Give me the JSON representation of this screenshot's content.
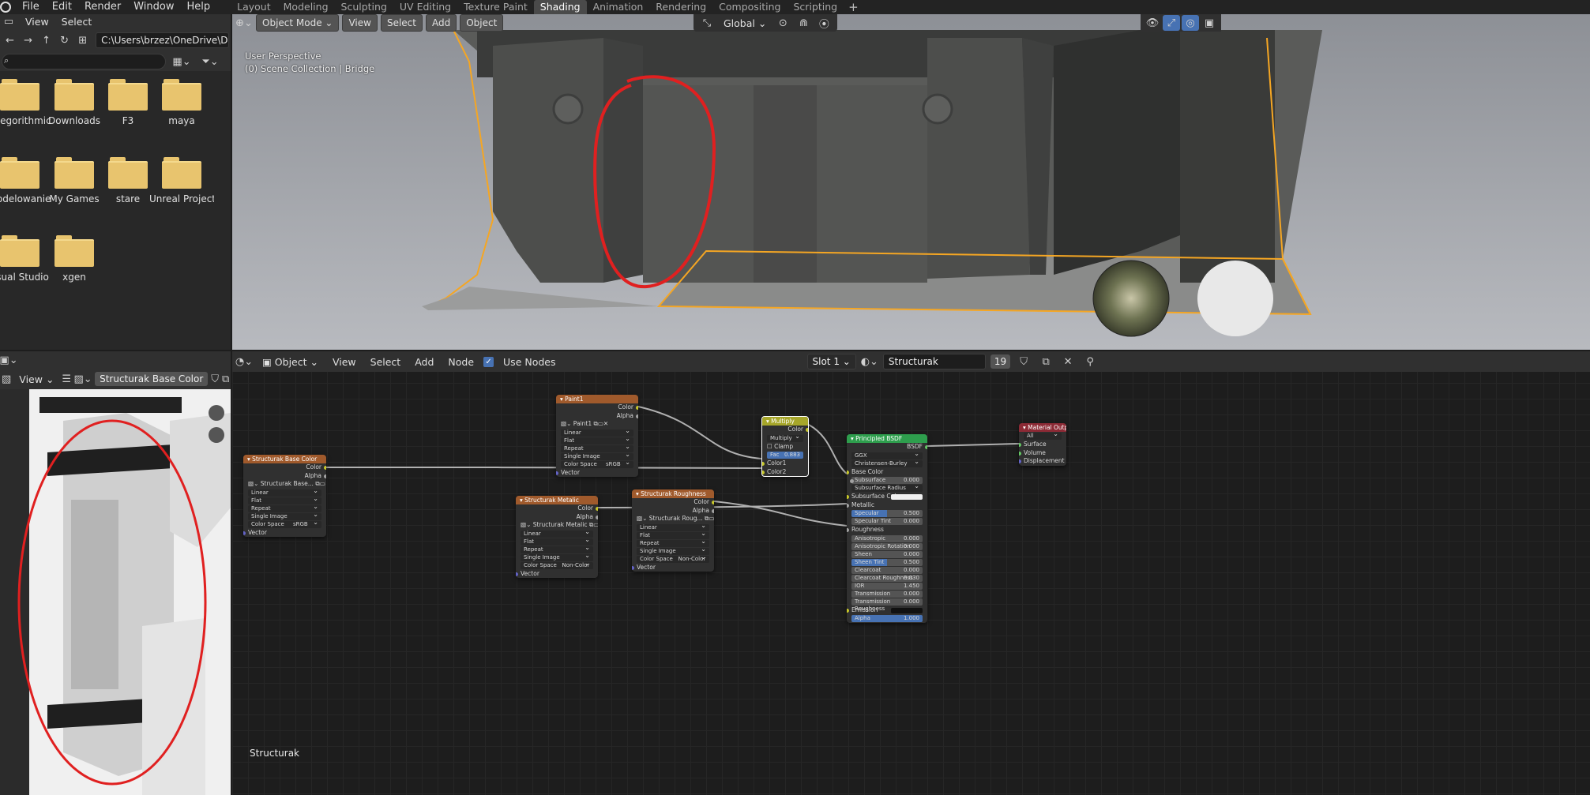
{
  "topbar": {
    "menus": [
      "File",
      "Edit",
      "Render",
      "Window",
      "Help"
    ],
    "workspaces": [
      "Layout",
      "Modeling",
      "Sculpting",
      "UV Editing",
      "Texture Paint",
      "Shading",
      "Animation",
      "Rendering",
      "Compositing",
      "Scripting"
    ],
    "active_workspace": "Shading",
    "add_workspace": "+"
  },
  "filebrowser": {
    "menus": [
      "View",
      "Select"
    ],
    "path": "C:\\Users\\brzez\\OneDrive\\Dokumenty\\",
    "folders": [
      "Allegorithmic",
      "Downloads",
      "F3",
      "maya",
      "Modelowanie",
      "My Games",
      "stare",
      "Unreal Project",
      "Visual Studio ...",
      "xgen"
    ]
  },
  "viewport": {
    "mode": "Object Mode",
    "menus": [
      "View",
      "Select",
      "Add",
      "Object"
    ],
    "transform_orientation": "Global",
    "perspective_label": "User Perspective",
    "collection_label": "(0) Scene Collection | Bridge"
  },
  "imgeditor": {
    "view_menu": "View",
    "image_name": "Structurak Base Color"
  },
  "nodeeditor": {
    "type": "Object",
    "menus": [
      "View",
      "Select",
      "Add",
      "Node"
    ],
    "use_nodes_label": "Use Nodes",
    "slot": "Slot 1",
    "material": "Structurak",
    "users": "19",
    "tree_label": "Structurak",
    "nodes": {
      "base_color": {
        "title": "Structurak Base Color",
        "outputs": [
          "Color",
          "Alpha"
        ],
        "image": "Structurak Base...",
        "interp": "Linear",
        "proj": "Flat",
        "ext": "Repeat",
        "source": "Single Image",
        "colorspace_label": "Color Space",
        "colorspace": "sRGB",
        "vector": "Vector"
      },
      "paint": {
        "title": "Paint1",
        "outputs": [
          "Color",
          "Alpha"
        ],
        "image": "Paint1",
        "interp": "Linear",
        "proj": "Flat",
        "ext": "Repeat",
        "source": "Single Image",
        "colorspace_label": "Color Space",
        "colorspace": "sRGB",
        "vector": "Vector"
      },
      "metallic": {
        "title": "Structurak Metalic",
        "outputs": [
          "Color",
          "Alpha"
        ],
        "image": "Structurak Metalic",
        "interp": "Linear",
        "proj": "Flat",
        "ext": "Repeat",
        "source": "Single Image",
        "colorspace_label": "Color Space",
        "colorspace": "Non-Color",
        "vector": "Vector"
      },
      "roughness": {
        "title": "Structurak Roughness",
        "outputs": [
          "Color",
          "Alpha"
        ],
        "image": "Structurak Roug...",
        "interp": "Linear",
        "proj": "Flat",
        "ext": "Repeat",
        "source": "Single Image",
        "colorspace_label": "Color Space",
        "colorspace": "Non-Color",
        "vector": "Vector"
      },
      "multiply": {
        "title": "Multiply",
        "output": "Color",
        "blend": "Multiply",
        "clamp": "Clamp",
        "fac_label": "Fac",
        "fac": "0.883",
        "inputs": [
          "Color1",
          "Color2"
        ]
      },
      "bsdf": {
        "title": "Principled BSDF",
        "output": "BSDF",
        "distribution": "GGX",
        "subsurface_method": "Christensen-Burley",
        "fields": [
          {
            "label": "Base Color",
            "value": ""
          },
          {
            "label": "Subsurface",
            "value": "0.000"
          },
          {
            "label": "Subsurface Radius",
            "value": ""
          },
          {
            "label": "Subsurface Color",
            "value": ""
          },
          {
            "label": "Metallic",
            "value": ""
          },
          {
            "label": "Specular",
            "value": "0.500"
          },
          {
            "label": "Specular Tint",
            "value": "0.000"
          },
          {
            "label": "Roughness",
            "value": ""
          },
          {
            "label": "Anisotropic",
            "value": "0.000"
          },
          {
            "label": "Anisotropic Rotation",
            "value": "0.000"
          },
          {
            "label": "Sheen",
            "value": "0.000"
          },
          {
            "label": "Sheen Tint",
            "value": "0.500"
          },
          {
            "label": "Clearcoat",
            "value": "0.000"
          },
          {
            "label": "Clearcoat Roughness",
            "value": "0.030"
          },
          {
            "label": "IOR",
            "value": "1.450"
          },
          {
            "label": "Transmission",
            "value": "0.000"
          },
          {
            "label": "Transmission Roughness",
            "value": "0.000"
          },
          {
            "label": "Emission",
            "value": ""
          },
          {
            "label": "Alpha",
            "value": "1.000"
          }
        ]
      },
      "output": {
        "title": "Material Output",
        "target": "All",
        "inputs": [
          "Surface",
          "Volume",
          "Displacement"
        ]
      }
    }
  },
  "colors": {
    "accent": "#4772b3",
    "selection_outline": "#f5a623",
    "annotation": "#e02020",
    "texture_node_header": "#a05a2c",
    "mix_node_header": "#a6a62a",
    "shader_node_header": "#2e9e4d",
    "output_node_header": "#8c2a35"
  }
}
